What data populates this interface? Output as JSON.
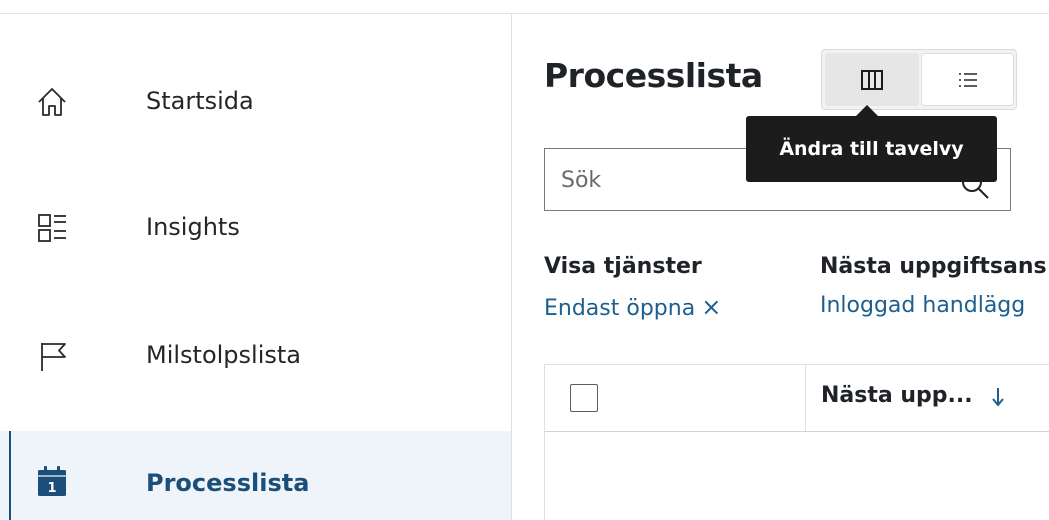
{
  "sidebar": {
    "items": [
      {
        "label": "Startsida",
        "icon": "home-icon",
        "active": false
      },
      {
        "label": "Insights",
        "icon": "insights-list-icon",
        "active": false
      },
      {
        "label": "Milstolpslista",
        "icon": "flag-icon",
        "active": false
      },
      {
        "label": "Processlista",
        "icon": "calendar-icon",
        "active": true,
        "icon_badge": "1"
      }
    ]
  },
  "header": {
    "title": "Processlista",
    "view_toggle": {
      "board_icon": "board-view-icon",
      "list_icon": "list-view-icon",
      "selected": "board"
    },
    "tooltip": "Ändra till tavelvy"
  },
  "search": {
    "placeholder": "Sök",
    "value": "",
    "icon": "search-icon"
  },
  "filters": [
    {
      "title": "Visa tjänster",
      "value": "Endast öppna",
      "clear_symbol": "×"
    },
    {
      "title": "Nästa uppgiftsans",
      "value": "Inloggad handlägg"
    }
  ],
  "table": {
    "columns": [
      {
        "label": "Nästa upp...",
        "sort_symbol": "↓"
      }
    ]
  },
  "colors": {
    "accent": "#1b4f7a",
    "link": "#1d5f8f",
    "active_bg": "#eef4f9",
    "tooltip_bg": "#1c1c1c"
  }
}
